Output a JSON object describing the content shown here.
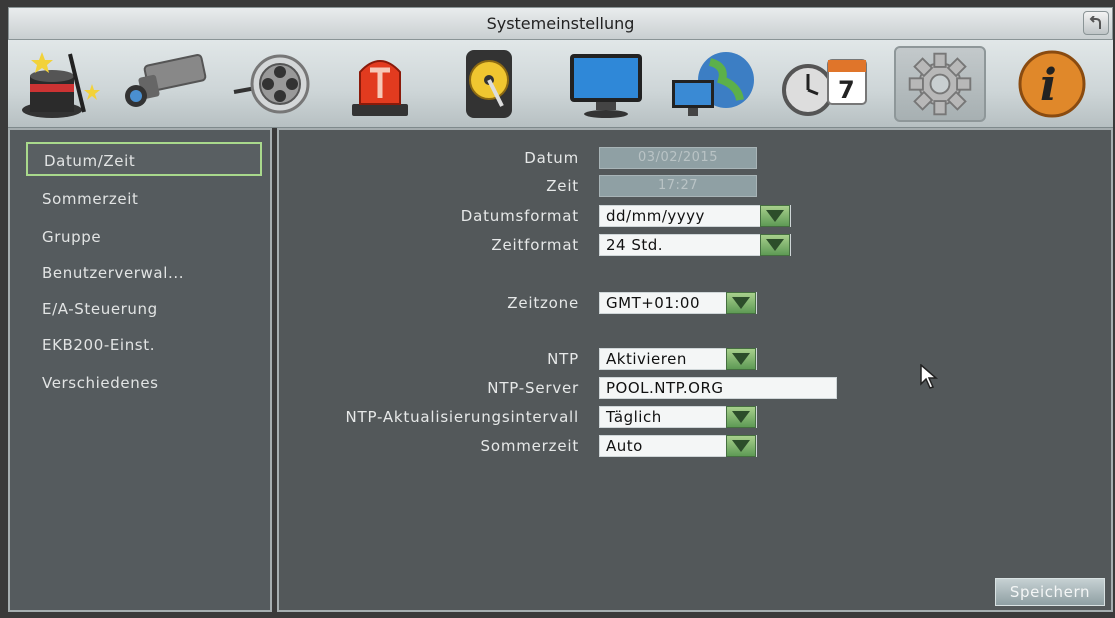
{
  "window": {
    "title": "Systemeinstellung",
    "back_icon": "back-arrow-icon"
  },
  "toolbar": {
    "icons": [
      "wizard-icon",
      "camera-icon",
      "record-icon",
      "alarm-icon",
      "storage-icon",
      "display-icon",
      "network-icon",
      "schedule-icon",
      "system-settings-icon",
      "info-icon"
    ],
    "selected": "system-settings-icon"
  },
  "sidebar": {
    "items": [
      {
        "label": "Datum/Zeit"
      },
      {
        "label": "Sommerzeit"
      },
      {
        "label": "Gruppe"
      },
      {
        "label": "Benutzerverwal..."
      },
      {
        "label": "E/A-Steuerung"
      },
      {
        "label": "EKB200-Einst."
      },
      {
        "label": "Verschiedenes"
      }
    ],
    "active_index": 0
  },
  "form": {
    "datum": {
      "label": "Datum",
      "value": "03/02/2015"
    },
    "zeit": {
      "label": "Zeit",
      "value": "17:27"
    },
    "datumsformat": {
      "label": "Datumsformat",
      "value": "dd/mm/yyyy"
    },
    "zeitformat": {
      "label": "Zeitformat",
      "value": "24 Std."
    },
    "zeitzone": {
      "label": "Zeitzone",
      "value": "GMT+01:00"
    },
    "ntp": {
      "label": "NTP",
      "value": "Aktivieren"
    },
    "ntp_server": {
      "label": "NTP-Server",
      "value": "POOL.NTP.ORG"
    },
    "ntp_interval": {
      "label": "NTP-Aktualisierungsintervall",
      "value": "Täglich"
    },
    "sommerzeit": {
      "label": "Sommerzeit",
      "value": "Auto"
    }
  },
  "actions": {
    "save_label": "Speichern"
  },
  "colors": {
    "accent_green": "#a9d98c",
    "panel": "#53585a"
  }
}
